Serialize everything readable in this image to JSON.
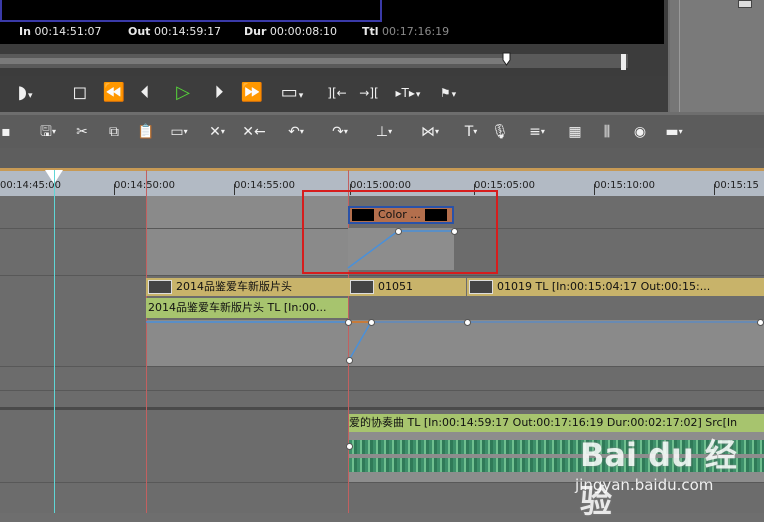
{
  "preview": {
    "in_label": "In",
    "in_value": "00:14:51:07",
    "out_label": "Out",
    "out_value": "00:14:59:17",
    "dur_label": "Dur",
    "dur_value": "00:00:08:10",
    "ttl_label": "Ttl",
    "ttl_value": "00:17:16:19"
  },
  "ruler": {
    "labels": [
      "00:14:45:00",
      "00:14:50:00",
      "00:14:55:00",
      "00:15:00:00",
      "00:15:05:00",
      "00:15:10:00",
      "00:15:15"
    ]
  },
  "tracks": {
    "title_clip": "Color ...",
    "video_clip_1": "2014品鉴爱车新版片头",
    "video_clip_2": "01051",
    "video_clip_3": "01019   TL [In:00:15:04:17 Out:00:15:...",
    "video_info_1": "2014品鉴爱车新版片头   TL [In:00...",
    "audio_clip": "爱的协奏曲   TL [In:00:14:59:17 Out:00:17:16:19 Dur:00:02:17:02]   Src[In"
  },
  "watermark": {
    "logo": "Bai du 经验",
    "url": "jingyan.baidu.com"
  },
  "colors": {
    "accent": "#55d13a",
    "highlight": "#d61d1d",
    "clip_video": "#c8b36a",
    "clip_title": "#b36f4d",
    "audio": "#3d8f6a"
  }
}
